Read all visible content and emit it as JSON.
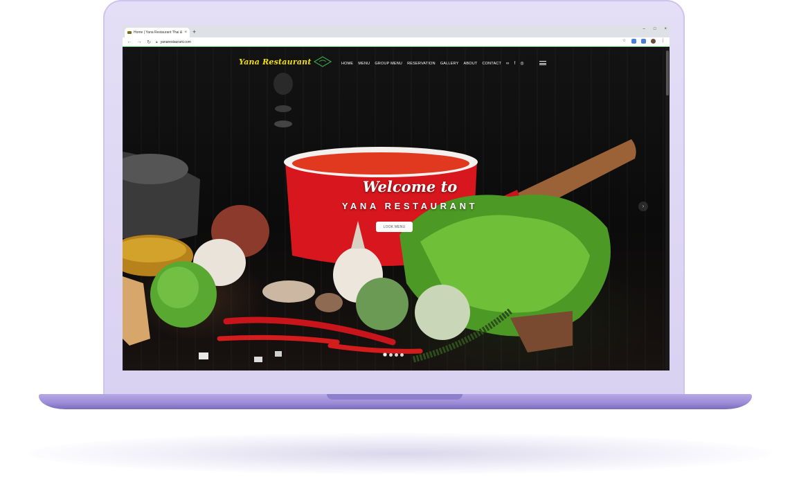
{
  "browser": {
    "tab_title": "Home | Yana Restaurant Thai & S",
    "tab_close": "×",
    "new_tab": "+",
    "url": "yanarestaurant.com",
    "window_controls": [
      "–",
      "□",
      "×"
    ]
  },
  "site": {
    "logo_text": "Yana Restaurant",
    "nav": [
      "HOME",
      "MENU",
      "GROUP MENU",
      "RESERVATION",
      "GALLERY",
      "ABOUT",
      "CONTACT"
    ],
    "social_icons": [
      "tripadvisor-icon",
      "facebook-icon",
      "instagram-icon"
    ]
  },
  "hero": {
    "welcome": "Welcome to",
    "title": "YANA RESTAURANT",
    "button": "LOOK MENU",
    "slide_count": 4,
    "active_slide": 1
  },
  "colors": {
    "logo": "#f2e000",
    "pot_red": "#d8161d",
    "lettuce": "#5fa82c",
    "laptop_frame": "#dcd5f3",
    "laptop_base": "#9a8bd6"
  }
}
